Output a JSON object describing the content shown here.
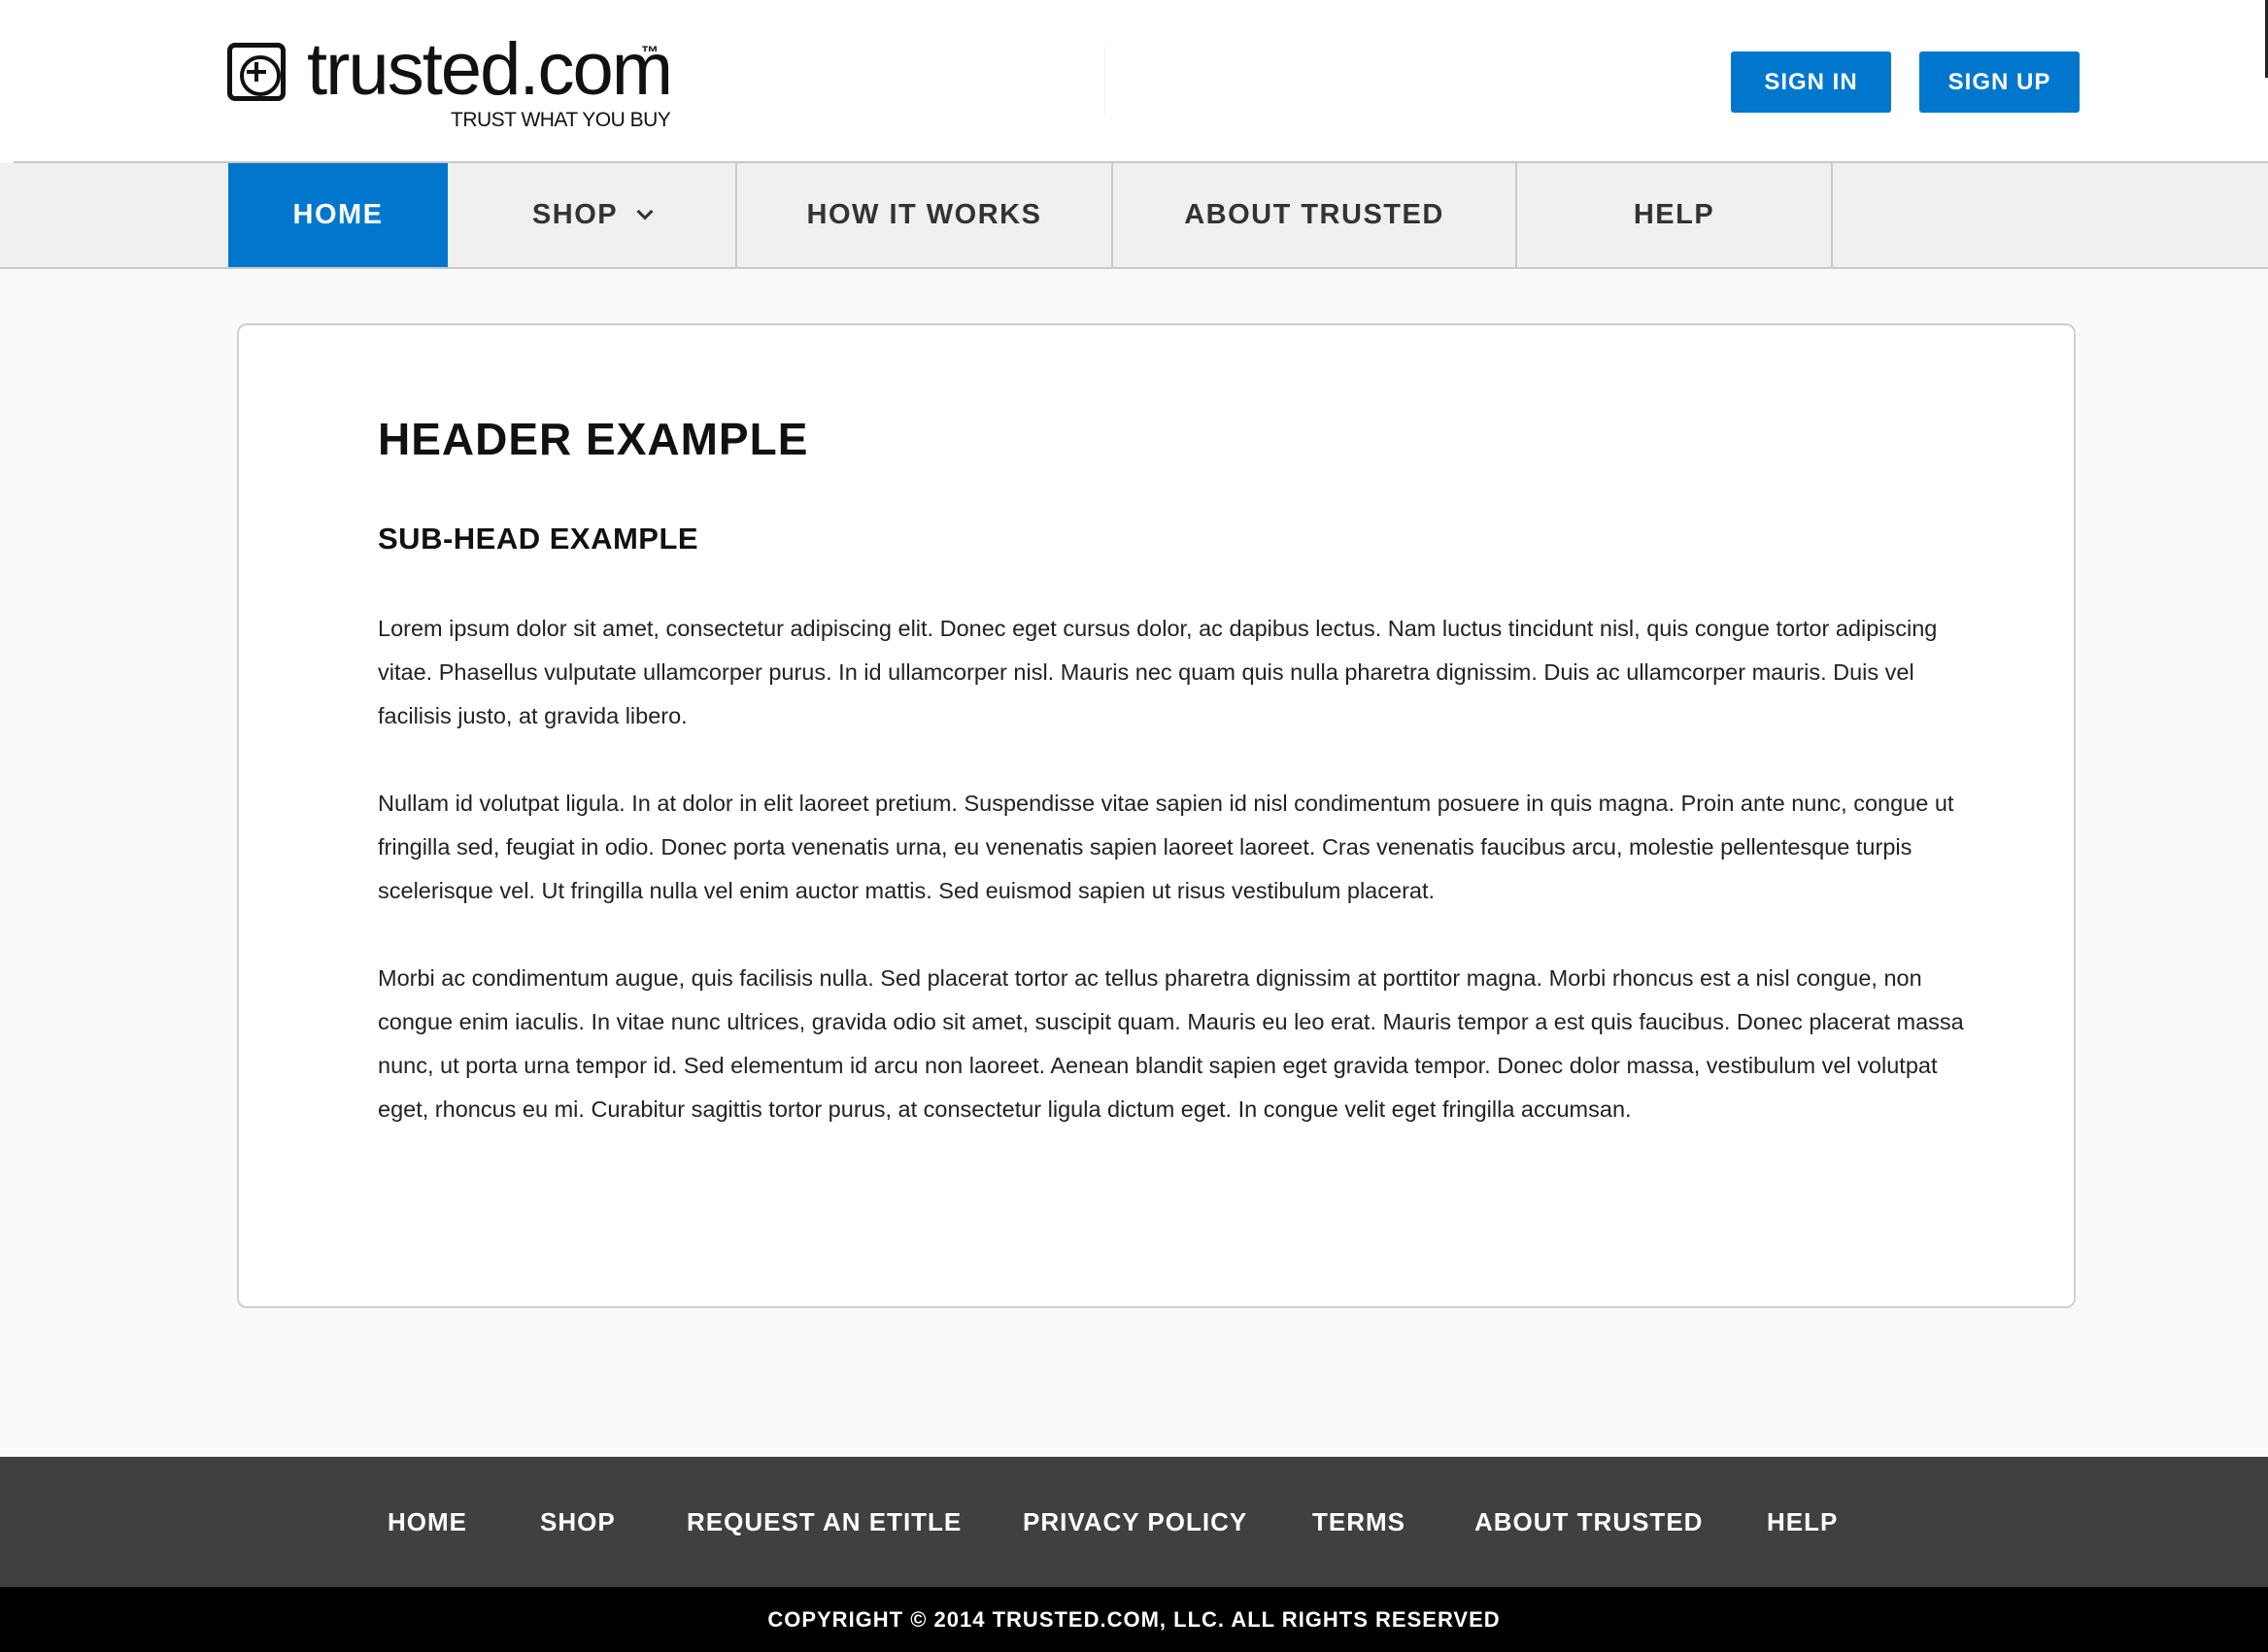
{
  "header": {
    "logo_word": "trusted.com",
    "logo_tm": "™",
    "logo_tagline": "TRUST WHAT YOU BUY",
    "sign_in": "SIGN IN",
    "sign_up": "SIGN UP"
  },
  "nav": {
    "items": [
      {
        "label": "HOME",
        "active": true
      },
      {
        "label": "SHOP",
        "has_dropdown": true
      },
      {
        "label": "HOW IT WORKS"
      },
      {
        "label": "ABOUT TRUSTED"
      },
      {
        "label": "HELP"
      }
    ]
  },
  "content": {
    "header": "HEADER EXAMPLE",
    "subhead": "SUB-HEAD EXAMPLE",
    "paragraphs": [
      "Lorem ipsum dolor sit amet, consectetur adipiscing elit. Donec eget cursus dolor, ac dapibus lectus. Nam luctus tincidunt nisl, quis congue tortor adipiscing vitae. Phasellus vulputate ullamcorper purus. In id ullamcorper nisl. Mauris nec quam quis nulla pharetra dignissim. Duis ac ullamcorper mauris. Duis vel facilisis justo, at gravida libero.",
      "Nullam id volutpat ligula. In at dolor in elit laoreet pretium. Suspendisse vitae sapien id nisl condimentum posuere in quis magna. Proin ante nunc, congue ut fringilla sed, feugiat in odio. Donec porta venenatis urna, eu venenatis sapien laoreet laoreet. Cras venenatis faucibus arcu, molestie pellentesque turpis scelerisque vel. Ut fringilla nulla vel enim auctor mattis. Sed euismod sapien ut risus vestibulum placerat.",
      "Morbi ac condimentum augue, quis facilisis nulla. Sed placerat tortor ac tellus pharetra dignissim at porttitor magna. Morbi rhoncus est a nisl congue, non congue enim iaculis. In vitae nunc ultrices, gravida odio sit amet, suscipit quam. Mauris eu leo erat. Mauris tempor a est quis faucibus. Donec placerat massa nunc, ut porta urna tempor id. Sed elementum id arcu non laoreet. Aenean blandit sapien eget gravida tempor. Donec dolor massa, vestibulum vel volutpat eget, rhoncus eu mi. Curabitur sagittis tortor purus, at consectetur ligula dictum eget. In congue velit eget fringilla accumsan."
    ]
  },
  "footer": {
    "links": [
      "HOME",
      "SHOP",
      "REQUEST AN ETITLE",
      "PRIVACY POLICY",
      "TERMS",
      "ABOUT TRUSTED",
      "HELP"
    ],
    "copyright": "COPYRIGHT © 2014 TRUSTED.COM, LLC. ALL RIGHTS RESERVED"
  },
  "colors": {
    "accent": "#0077cc",
    "footer_bg": "#404040",
    "copyright_bg": "#000000",
    "nav_bg": "#f0f0f0"
  }
}
